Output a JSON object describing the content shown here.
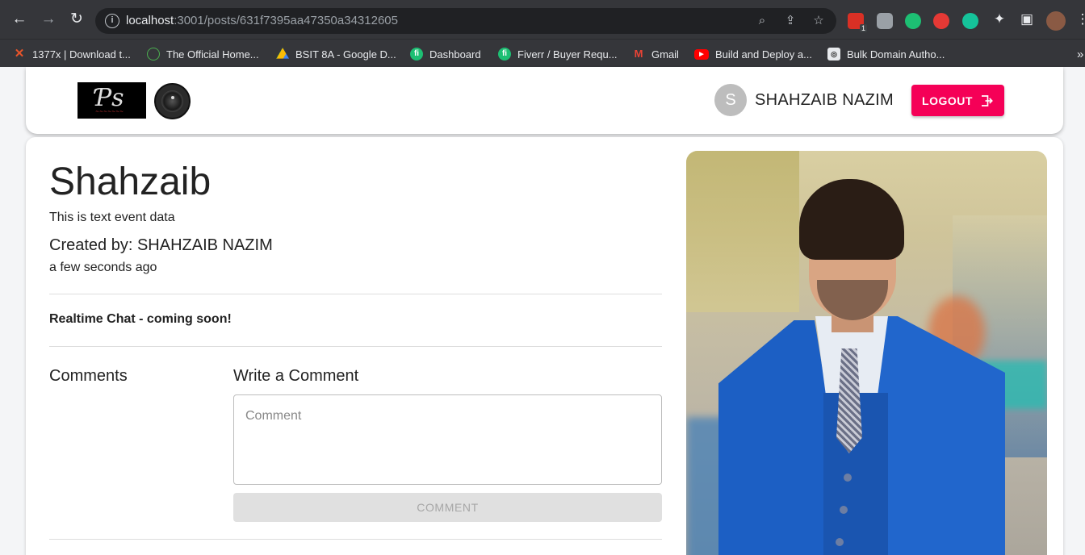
{
  "browser": {
    "url_host": "localhost",
    "url_path": ":3001/posts/631f7395aa47350a34312605",
    "bookmarks": [
      {
        "label": "1377x | Download t...",
        "icon": "x-icon",
        "color": "#e8542a"
      },
      {
        "label": "The Official Home...",
        "icon": "site-icon",
        "color": "#4caf50"
      },
      {
        "label": "BSIT 8A - Google D...",
        "icon": "drive-icon",
        "color": "#fbbc04"
      },
      {
        "label": "Dashboard",
        "icon": "fiverr-icon",
        "color": "#1dbf73"
      },
      {
        "label": "Fiverr / Buyer Requ...",
        "icon": "fiverr-icon",
        "color": "#1dbf73"
      },
      {
        "label": "Gmail",
        "icon": "gmail-icon",
        "color": "#ea4335"
      },
      {
        "label": "Build and Deploy a...",
        "icon": "youtube-icon",
        "color": "#ff0000"
      },
      {
        "label": "Bulk Domain Autho...",
        "icon": "domain-icon",
        "color": "#9e9e9e"
      }
    ],
    "overflow": "»",
    "ext_badge": "1"
  },
  "header": {
    "avatar_letter": "S",
    "username": "SHAHZAIB NAZIM",
    "logout_label": "LOGOUT",
    "accent": "#f50057"
  },
  "post": {
    "title": "Shahzaib",
    "description": "This is text event data",
    "created_by": "Created by: SHAHZAIB NAZIM",
    "time_ago": "a few seconds ago",
    "chat_note": "Realtime Chat - coming soon!"
  },
  "comments": {
    "heading": "Comments",
    "write_heading": "Write a Comment",
    "placeholder": "Comment",
    "button_label": "COMMENT"
  }
}
